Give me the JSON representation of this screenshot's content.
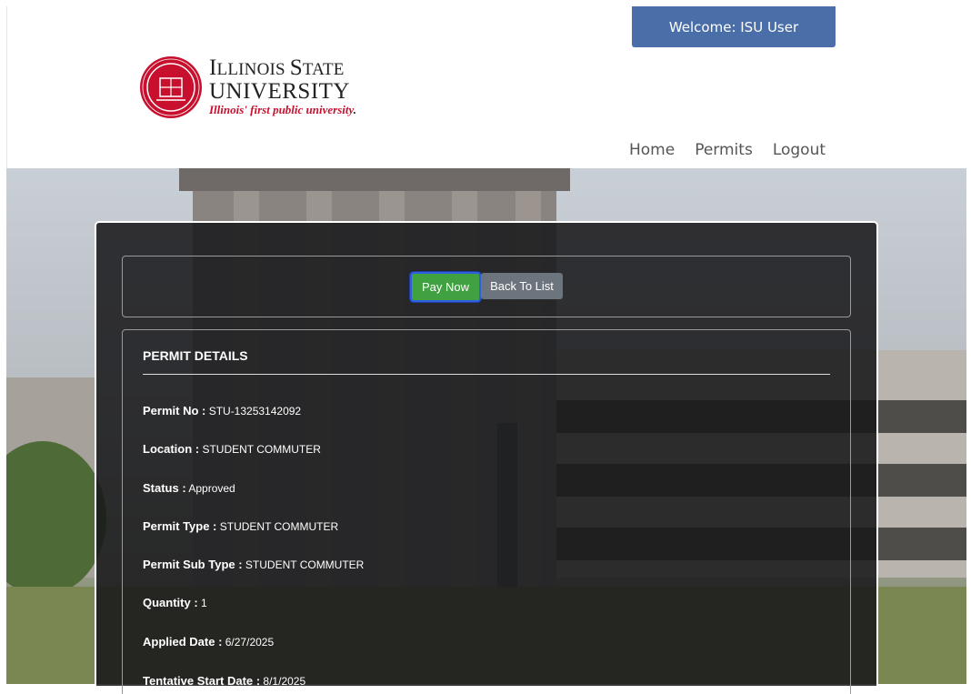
{
  "header": {
    "welcome": "Welcome: ISU User",
    "logo": {
      "line1_big_i": "I",
      "line1_rest": "LLINOIS ",
      "line1_big_s": "S",
      "line1_rest2": "TATE",
      "line2": "UNIVERSITY",
      "tagline": "Illinois' first public university",
      "tagline_dot": "."
    },
    "nav": [
      "Home",
      "Permits",
      "Logout"
    ]
  },
  "actions": {
    "pay_now": "Pay Now",
    "back_to_list": "Back To List"
  },
  "details": {
    "title": "PERMIT DETAILS",
    "rows": [
      {
        "label": "Permit No :",
        "value": "STU-13253142092"
      },
      {
        "label": "Location :",
        "value": "STUDENT COMMUTER"
      },
      {
        "label": "Status :",
        "value": "Approved"
      },
      {
        "label": "Permit Type :",
        "value": "STUDENT COMMUTER"
      },
      {
        "label": "Permit Sub Type :",
        "value": "STUDENT COMMUTER"
      },
      {
        "label": "Quantity :",
        "value": "1"
      },
      {
        "label": "Applied Date :",
        "value": "6/27/2025"
      },
      {
        "label": "Tentative Start Date :",
        "value": "8/1/2025"
      }
    ]
  },
  "colors": {
    "welcome_bg": "#4a6fa8",
    "pay_now_bg": "#3fa13f",
    "back_bg": "#6c757d",
    "brand_red": "#c8102e"
  }
}
